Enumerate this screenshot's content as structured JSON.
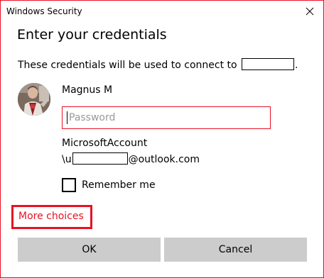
{
  "window": {
    "title": "Windows Security",
    "close_icon": "close-icon",
    "accent_color": "#e81123"
  },
  "heading": "Enter your credentials",
  "description": {
    "text": "These credentials will be used to connect to",
    "suffix": "."
  },
  "user": {
    "name": "Magnus M",
    "avatar_icon": "user-avatar"
  },
  "password": {
    "placeholder": "Password",
    "value": ""
  },
  "account": {
    "line1": "MicrosoftAccount",
    "prefix": "\\u",
    "suffix": "@outlook.com"
  },
  "remember": {
    "label": "Remember me",
    "checked": false
  },
  "more_choices": "More choices",
  "buttons": {
    "ok": "OK",
    "cancel": "Cancel"
  }
}
